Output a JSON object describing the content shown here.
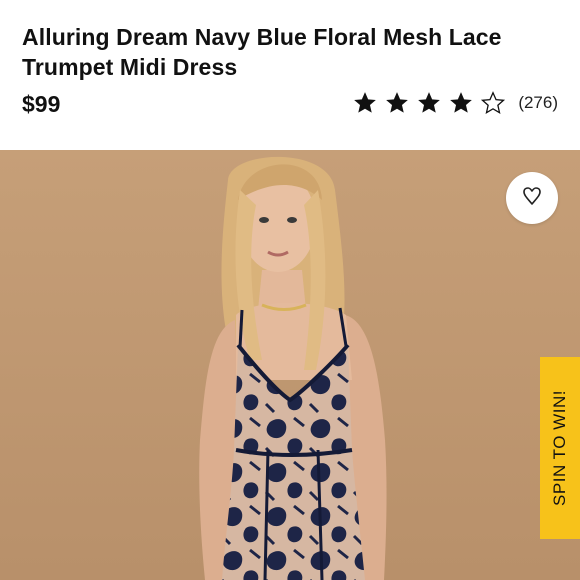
{
  "product": {
    "title_line1": "Alluring Dream Navy Blue Floral Mesh Lace",
    "title_line2": "Trumpet Midi Dress",
    "price": "$99",
    "rating": {
      "filled_stars": 4,
      "total_stars": 5,
      "review_count": "(276)"
    }
  },
  "image": {
    "alt": "Model wearing navy blue floral mesh lace midi dress"
  },
  "actions": {
    "favorite_icon": "heart-icon"
  },
  "promo": {
    "spin_label": "SPIN TO WIN!"
  },
  "colors": {
    "background": "#c29a73",
    "dress": "#1e2547",
    "promo_tab": "#f7c21a"
  }
}
